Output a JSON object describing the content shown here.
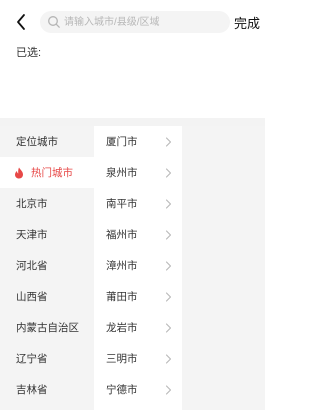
{
  "header": {
    "search_placeholder": "请输入城市/县级/区域",
    "done_label": "完成"
  },
  "selected": {
    "label": "已选:"
  },
  "provinces": [
    {
      "label": "定位城市",
      "active": false
    },
    {
      "label": "热门城市",
      "active": true
    },
    {
      "label": "北京市",
      "active": false
    },
    {
      "label": "天津市",
      "active": false
    },
    {
      "label": "河北省",
      "active": false
    },
    {
      "label": "山西省",
      "active": false
    },
    {
      "label": "内蒙古自治区",
      "active": false
    },
    {
      "label": "辽宁省",
      "active": false
    },
    {
      "label": "吉林省",
      "active": false
    }
  ],
  "cities": [
    {
      "label": "厦门市"
    },
    {
      "label": "泉州市"
    },
    {
      "label": "南平市"
    },
    {
      "label": "福州市"
    },
    {
      "label": "漳州市"
    },
    {
      "label": "莆田市"
    },
    {
      "label": "龙岩市"
    },
    {
      "label": "三明市"
    },
    {
      "label": "宁德市"
    }
  ],
  "colors": {
    "accent": "#e74847",
    "panel": "#f4f4f4"
  },
  "icons": {
    "back": "chevron-left-icon",
    "search": "search-icon",
    "hot": "fire-icon",
    "row": "chevron-right-icon"
  }
}
